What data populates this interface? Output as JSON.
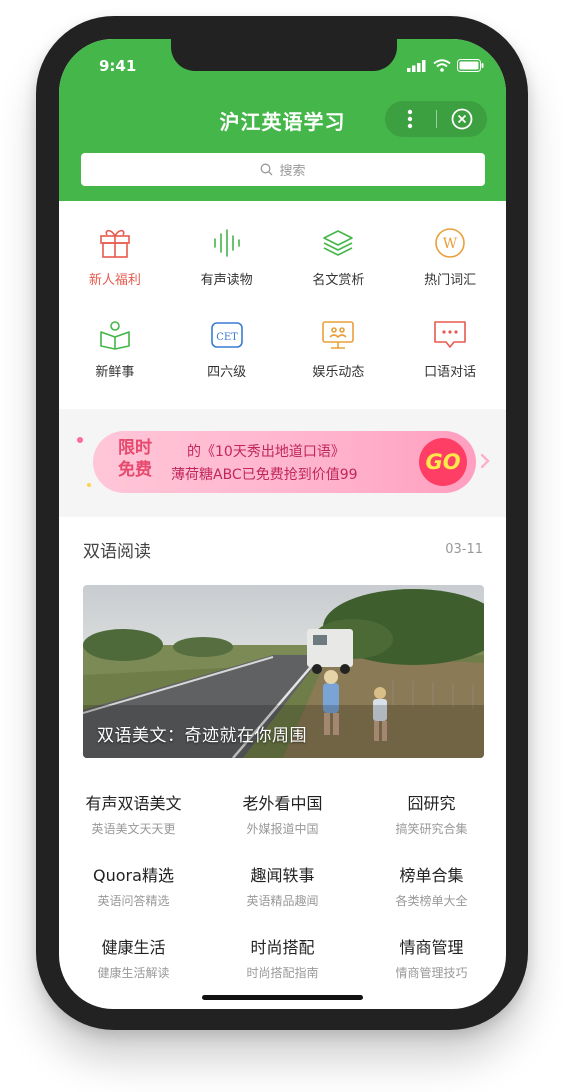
{
  "status": {
    "time": "9:41"
  },
  "header": {
    "title": "沪江英语学习"
  },
  "search": {
    "placeholder": "搜索"
  },
  "grid": {
    "row1": [
      {
        "label": "新人福利",
        "icon": "gift-icon"
      },
      {
        "label": "有声读物",
        "icon": "audio-wave-icon"
      },
      {
        "label": "名文赏析",
        "icon": "layers-icon"
      },
      {
        "label": "热门词汇",
        "icon": "w-badge-icon"
      }
    ],
    "row2": [
      {
        "label": "新鲜事",
        "icon": "open-book-icon"
      },
      {
        "label": "四六级",
        "icon": "cet-icon"
      },
      {
        "label": "娱乐动态",
        "icon": "monitor-icon"
      },
      {
        "label": "口语对话",
        "icon": "chat-bubble-icon"
      }
    ]
  },
  "banner": {
    "badge_line1": "限时",
    "badge_line2": "免费",
    "line1": "的《10天秀出地道口语》",
    "line2": "薄荷糖ABC已免费抢到价值99",
    "go": "GO"
  },
  "section": {
    "title": "双语阅读",
    "date": "03-11"
  },
  "hero": {
    "caption": "双语美文：奇迹就在你周围"
  },
  "categories": [
    [
      {
        "title": "有声双语美文",
        "subtitle": "英语美文天天更"
      },
      {
        "title": "老外看中国",
        "subtitle": "外媒报道中国"
      },
      {
        "title": "囧研究",
        "subtitle": "搞笑研究合集"
      }
    ],
    [
      {
        "title": "Quora精选",
        "subtitle": "英语问答精选"
      },
      {
        "title": "趣闻轶事",
        "subtitle": "英语精品趣闻"
      },
      {
        "title": "榜单合集",
        "subtitle": "各类榜单大全"
      }
    ],
    [
      {
        "title": "健康生活",
        "subtitle": "健康生活解读"
      },
      {
        "title": "时尚搭配",
        "subtitle": "时尚搭配指南"
      },
      {
        "title": "情商管理",
        "subtitle": "情商管理技巧"
      }
    ]
  ],
  "colors": {
    "brand_green": "#45b649",
    "hot_red": "#e85a4f",
    "go_pink": "#ff3e66"
  }
}
